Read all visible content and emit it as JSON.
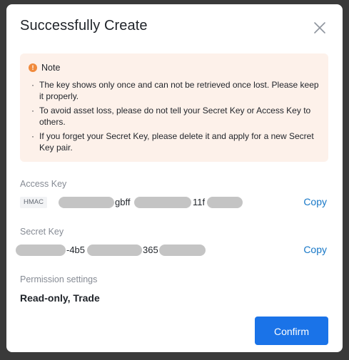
{
  "dialog": {
    "title": "Successfully Create",
    "close_icon": "close-icon"
  },
  "note": {
    "icon": "warning-icon",
    "title": "Note",
    "items": [
      "The key shows only once and can not be retrieved once lost. Please keep it properly.",
      "To avoid asset loss, please do not tell your Secret Key or Access Key to others.",
      "If you forget your Secret Key, please delete it and apply for a new Secret Key pair."
    ]
  },
  "access_key": {
    "label": "Access Key",
    "tag": "HMAC",
    "fragments": [
      "gbff",
      "11f"
    ],
    "copy_label": "Copy"
  },
  "secret_key": {
    "label": "Secret Key",
    "fragments": [
      "-4b5",
      "365"
    ],
    "copy_label": "Copy"
  },
  "permission": {
    "label": "Permission settings",
    "value": "Read-only, Trade"
  },
  "confirm_label": "Confirm",
  "colors": {
    "accent": "#1a73e8",
    "link": "#1677c7",
    "note_bg": "#fdf1ea",
    "warning": "#f08a3c"
  }
}
